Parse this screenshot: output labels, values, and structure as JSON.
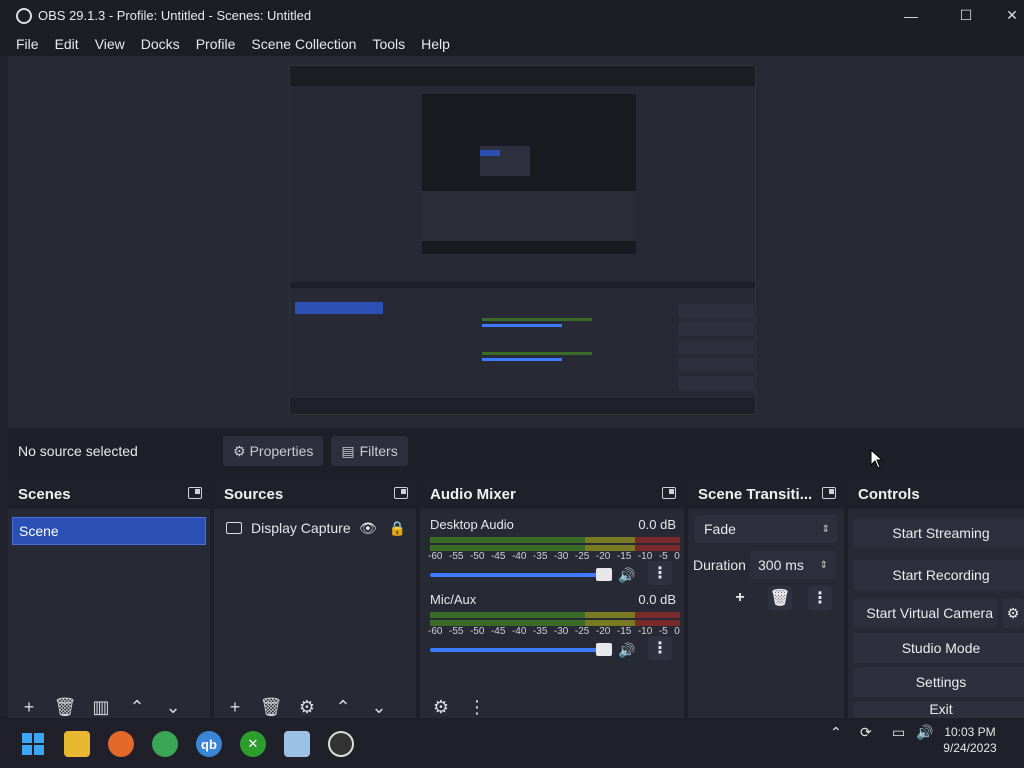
{
  "window": {
    "title": "OBS 29.1.3 - Profile: Untitled - Scenes: Untitled",
    "minimize": "—",
    "maximize": "☐",
    "close": "✕"
  },
  "menu": [
    "File",
    "Edit",
    "View",
    "Docks",
    "Profile",
    "Scene Collection",
    "Tools",
    "Help"
  ],
  "source_toolbar": {
    "no_source": "No source selected",
    "properties": "Properties",
    "filters": "Filters"
  },
  "docks": {
    "scenes": {
      "title": "Scenes",
      "items": [
        "Scene"
      ]
    },
    "sources": {
      "title": "Sources",
      "items": [
        "Display Capture"
      ]
    },
    "audio_mixer": {
      "title": "Audio Mixer",
      "channels": [
        {
          "name": "Desktop Audio",
          "db": "0.0 dB",
          "volume": 1.0
        },
        {
          "name": "Mic/Aux",
          "db": "0.0 dB",
          "volume": 1.0
        }
      ],
      "ticks": [
        "-60",
        "-55",
        "-50",
        "-45",
        "-40",
        "-35",
        "-30",
        "-25",
        "-20",
        "-15",
        "-10",
        "-5",
        "0"
      ]
    },
    "transitions": {
      "title": "Scene Transiti...",
      "selected": "Fade",
      "duration_label": "Duration",
      "duration_value": "300 ms"
    },
    "controls": {
      "title": "Controls",
      "buttons": [
        "Start Streaming",
        "Start Recording",
        "Start Virtual Camera",
        "Studio Mode",
        "Settings",
        "Exit"
      ]
    }
  },
  "taskbar": {
    "time": "10:03 PM",
    "date": "9/24/2023"
  },
  "colors": {
    "accent": "#2a4fb5",
    "slider": "#3c7bff",
    "bg": "#272935"
  }
}
